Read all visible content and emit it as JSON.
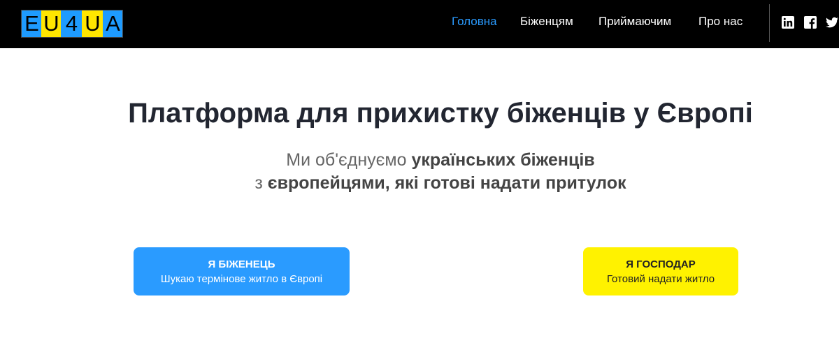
{
  "logo": {
    "letters": [
      "E",
      "U",
      "4",
      "U",
      "A"
    ]
  },
  "nav": {
    "items": [
      {
        "label": "Головна",
        "active": true
      },
      {
        "label": "Біженцям",
        "active": false
      },
      {
        "label": "Приймаючим",
        "active": false
      },
      {
        "label": "Про нас",
        "active": false
      }
    ]
  },
  "social": [
    "linkedin-icon",
    "facebook-icon",
    "twitter-icon"
  ],
  "hero": {
    "title": "Платформа для прихистку біженців у Європі",
    "line1_plain": "Ми об'єднуємо",
    "line1_bold": "українських біженців",
    "line2_plain": "з",
    "line2_bold": "європейцями, які готові надати притулок"
  },
  "buttons": {
    "refugee": {
      "title": "Я БІЖЕНЕЦЬ",
      "subtitle": "Шукаю термінове житло в Європі"
    },
    "host": {
      "title": "Я ГОСПОДАР",
      "subtitle": "Готовий надати житло"
    }
  },
  "colors": {
    "accent_blue": "#2a9bff",
    "accent_yellow": "#fff200",
    "topbar": "#000000"
  }
}
